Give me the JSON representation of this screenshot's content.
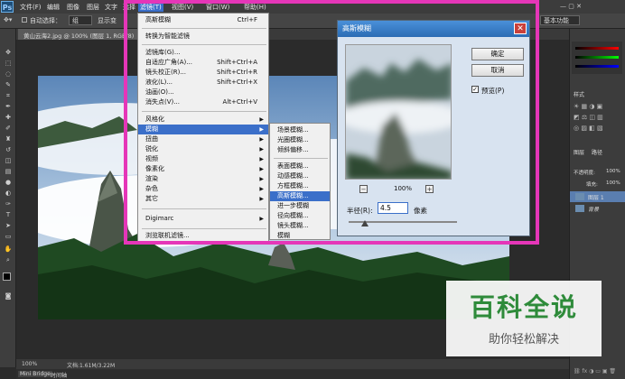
{
  "app": {
    "logo": "Ps",
    "menus": [
      "文件(F)",
      "编辑",
      "图像",
      "图层",
      "文字",
      "选择",
      "滤镜(T)",
      "视图(V)",
      "窗口(W)",
      "帮助(H)"
    ]
  },
  "options": {
    "tool_label": "自动选择：",
    "layer_option": "组",
    "show_transform": "显示变"
  },
  "workspace": {
    "label": "基本功能"
  },
  "document": {
    "tab_title": "黄山云海2.jpg @ 100% (图层 1, RGB/8)"
  },
  "filter_menu": {
    "items": [
      {
        "label": "高斯模糊",
        "shortcut": "Ctrl+F"
      },
      {
        "label": "转换为智能滤镜"
      },
      {
        "label": "滤镜库(G)..."
      },
      {
        "label": "自适应广角(A)...",
        "shortcut": "Shift+Ctrl+A"
      },
      {
        "label": "镜头校正(R)...",
        "shortcut": "Shift+Ctrl+R"
      },
      {
        "label": "液化(L)...",
        "shortcut": "Shift+Ctrl+X"
      },
      {
        "label": "油画(O)..."
      },
      {
        "label": "消失点(V)...",
        "shortcut": "Alt+Ctrl+V"
      },
      {
        "label": "风格化"
      },
      {
        "label": "模糊"
      },
      {
        "label": "扭曲"
      },
      {
        "label": "锐化"
      },
      {
        "label": "视频"
      },
      {
        "label": "像素化"
      },
      {
        "label": "渲染"
      },
      {
        "label": "杂色"
      },
      {
        "label": "其它"
      },
      {
        "label": "Digimarc"
      },
      {
        "label": "浏览联机滤镜..."
      }
    ]
  },
  "blur_submenu": {
    "items": [
      "场景模糊...",
      "光圈模糊...",
      "倾斜偏移...",
      "表面模糊...",
      "动感模糊...",
      "方框模糊...",
      "高斯模糊...",
      "进一步模糊",
      "径向模糊...",
      "镜头模糊...",
      "模糊"
    ]
  },
  "dialog": {
    "title": "高斯模糊",
    "ok": "确定",
    "cancel": "取消",
    "preview_label": "预览(P)",
    "preview_checked": true,
    "zoom": "100%",
    "radius_label": "半径(R):",
    "radius_value": "4.5",
    "unit": "像素",
    "radius_slider_fraction": 0.15
  },
  "status": {
    "zoom": "100%",
    "doc_info": "文档:1.61M/3.22M"
  },
  "bottom_tabs": [
    "Mini Bridge",
    "时间轴"
  ],
  "panel": {
    "tab_adjust": "样式",
    "tab_layers": "图层",
    "tab_paths": "路径",
    "opacity_label": "不透明度:",
    "opacity": "100%",
    "fill_label": "填充:",
    "fill": "100%",
    "layers": [
      "图层 1",
      "背景"
    ]
  },
  "watermark": {
    "title": "百科全说",
    "subtitle": "助你轻松解决"
  },
  "colors": {
    "highlight": "#3b6fc9",
    "frame": "#e536b8",
    "brand": "#2e8b3a"
  }
}
